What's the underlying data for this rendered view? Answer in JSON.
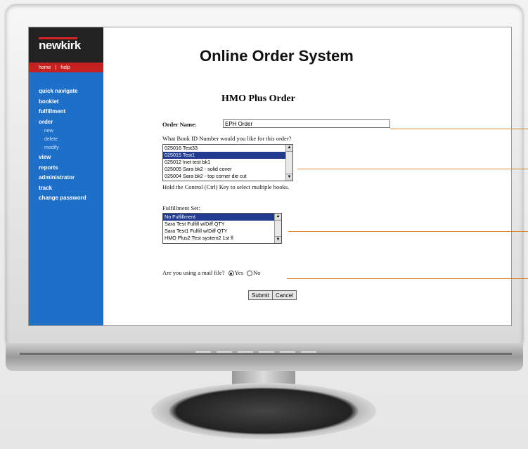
{
  "brand": {
    "logo": "newkirk",
    "subnav": [
      "home",
      "|",
      "help"
    ]
  },
  "sidebar": {
    "items": [
      {
        "label": "quick navigate"
      },
      {
        "label": "booklet"
      },
      {
        "label": "fulfillment"
      },
      {
        "label": "order"
      },
      {
        "label": "new",
        "sub": true
      },
      {
        "label": "delete",
        "sub": true
      },
      {
        "label": "modify",
        "sub": true
      },
      {
        "label": "view"
      },
      {
        "label": "reports"
      },
      {
        "label": "administrator"
      },
      {
        "label": "track"
      },
      {
        "label": "change password"
      }
    ]
  },
  "header": {
    "title": "Online Order System"
  },
  "form": {
    "title": "HMO Plus Order",
    "order_name_label": "Order Name:",
    "order_name_value": "EPH Order",
    "book_question": "What Book ID Number would you like for this order?",
    "books": [
      {
        "text": "025016 Test33"
      },
      {
        "text": "025015 Test1",
        "selected": true
      },
      {
        "text": "025012 Inet test bk1"
      },
      {
        "text": "025005 Sara bk2 - solid cover"
      },
      {
        "text": "025004 Sara bk2 - top corner die cut"
      }
    ],
    "hint": "Hold the Control (Ctrl) Key to select multiple books.",
    "fulfillment_label": "Fulfillment Set:",
    "fulfillment": [
      {
        "text": "No Fulfillment",
        "selected": true
      },
      {
        "text": "Sara Test Fulfill w/Diff QTY"
      },
      {
        "text": "Sara Test1 Fulfill w/Diff QTY"
      },
      {
        "text": "HMO Plus2 Test system2 1st fl"
      }
    ],
    "mail_question": "Are you using a mail file?",
    "radio_yes": "Yes",
    "radio_no": "No",
    "mail_selected": "Yes",
    "submit": "Submit",
    "cancel": "Cancel"
  },
  "colors": {
    "sidebar": "#1d6fc7",
    "accent_red": "#c62020",
    "selection": "#1f3a8f",
    "callout": "#d48a2a"
  }
}
